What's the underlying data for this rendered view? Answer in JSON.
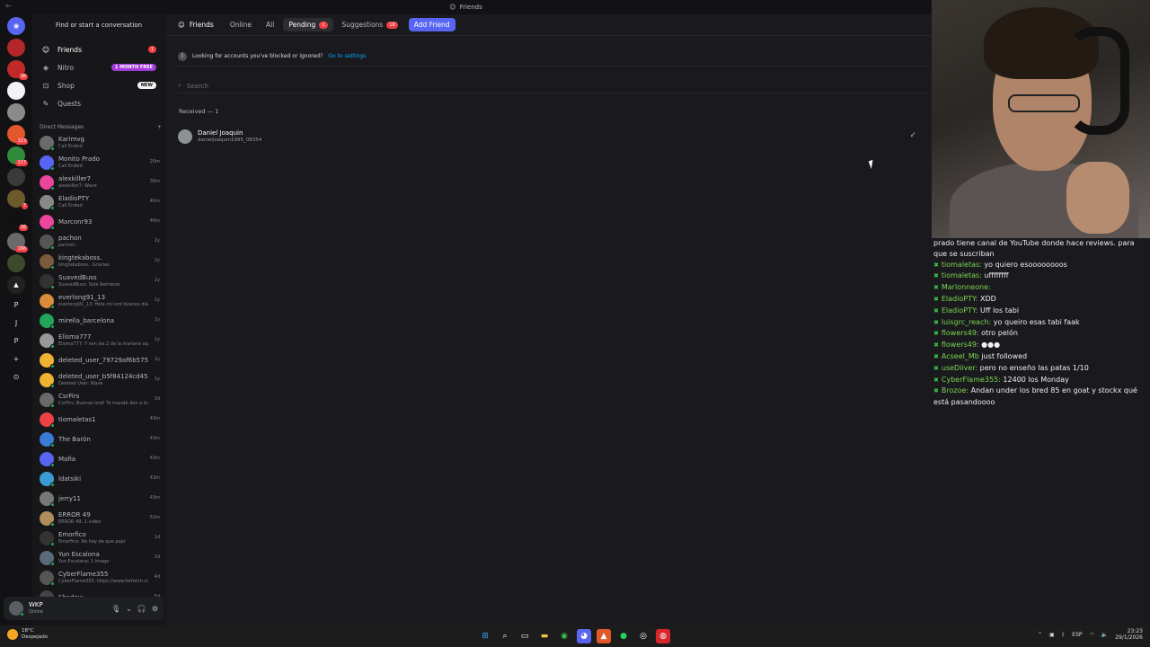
{
  "window": {
    "title": "Friends"
  },
  "rail": {
    "servers": [
      {
        "color": "#5865f2",
        "badge": "",
        "glyph": "◉"
      },
      {
        "color": "#b3262a",
        "badge": "",
        "glyph": ""
      },
      {
        "color": "#c22a2a",
        "badge": "36",
        "glyph": ""
      },
      {
        "color": "#f2f3f5",
        "badge": "",
        "glyph": ""
      },
      {
        "color": "#8a8a8a",
        "badge": "",
        "glyph": ""
      },
      {
        "color": "#e0582b",
        "badge": "323",
        "glyph": ""
      },
      {
        "color": "#2f8a3c",
        "badge": "117",
        "glyph": ""
      },
      {
        "color": "#3a3a3a",
        "badge": "",
        "glyph": ""
      },
      {
        "color": "#6c5a2a",
        "badge": "7",
        "glyph": ""
      },
      {
        "color": "#111111",
        "badge": "38",
        "glyph": ""
      },
      {
        "color": "#6a6a6a",
        "badge": "166",
        "glyph": ""
      },
      {
        "color": "#3b4a2a",
        "badge": "",
        "glyph": ""
      },
      {
        "color": "#222222",
        "badge": "",
        "glyph": "▲"
      }
    ],
    "letters": [
      "P",
      "J",
      "P"
    ]
  },
  "sidebar": {
    "find_placeholder": "Find or start a conversation",
    "nav": [
      {
        "label": "Friends",
        "icon": "friends-icon",
        "badge": "1",
        "badge_type": "red"
      },
      {
        "label": "Nitro",
        "icon": "nitro-icon",
        "badge": "1 MONTH FREE",
        "badge_type": "purple"
      },
      {
        "label": "Shop",
        "icon": "shop-icon",
        "badge": "NEW",
        "badge_type": "white"
      },
      {
        "label": "Quests",
        "icon": "quests-icon",
        "badge": "",
        "badge_type": ""
      }
    ],
    "dm_header": "Direct Messages",
    "dms": [
      {
        "name": "Karimvg",
        "sub": "Call Ended",
        "time": "",
        "color": "#6a6a6a"
      },
      {
        "name": "Monito Prado",
        "sub": "Call Ended",
        "time": "20m",
        "color": "#5865f2"
      },
      {
        "name": "alexkiller7",
        "sub": "alexkiller7: Wave",
        "time": "30m",
        "color": "#eb459e"
      },
      {
        "name": "EladioPTY",
        "sub": "Call Ended",
        "time": "40m",
        "color": "#888888"
      },
      {
        "name": "Marconr93",
        "sub": "",
        "time": "40m",
        "color": "#eb459e"
      },
      {
        "name": "pachon",
        "sub": "pachon:",
        "time": "2y",
        "color": "#555555"
      },
      {
        "name": "kingtekaboss.",
        "sub": "kingtekaboss.: Gracias",
        "time": "2y",
        "color": "#7a5a3a"
      },
      {
        "name": "SuavedBuss",
        "sub": "SuavedBuss: Sole Retriever",
        "time": "2y",
        "color": "#333333"
      },
      {
        "name": "everlong91_13",
        "sub": "everlong91_13: Hola mi lord buenos días s...",
        "time": "1y",
        "color": "#d98c3a"
      },
      {
        "name": "mirella_barcelona",
        "sub": "",
        "time": "1y",
        "color": "#23a55a"
      },
      {
        "name": "Elisma777",
        "sub": "Elisma777: Y son las 2 de la mañana aquí ...",
        "time": "1y",
        "color": "#999999"
      },
      {
        "name": "deleted_user_79729af6b575",
        "sub": "",
        "time": "1y",
        "color": "#f0b232"
      },
      {
        "name": "deleted_user_b5f84124cd45",
        "sub": "Deleted User: Wave",
        "time": "1y",
        "color": "#f0b232"
      },
      {
        "name": "CsrFirs",
        "sub": "CsrFirs: Buenas lord! Te mandé den a Insta...",
        "time": "3d",
        "color": "#6a6a6a"
      },
      {
        "name": "tiomaletas1",
        "sub": "",
        "time": "43m",
        "color": "#ed4245"
      },
      {
        "name": "The Barón",
        "sub": "",
        "time": "43m",
        "color": "#3a7bd5"
      },
      {
        "name": "Mafia",
        "sub": "",
        "time": "43m",
        "color": "#5865f2"
      },
      {
        "name": "ldatsiki",
        "sub": "",
        "time": "43m",
        "color": "#3a9bd5"
      },
      {
        "name": "jerry11",
        "sub": "",
        "time": "43m",
        "color": "#777777"
      },
      {
        "name": "ERROR 49",
        "sub": "ERROR 49: 1 video",
        "time": "52m",
        "color": "#b08d5a"
      },
      {
        "name": "Emorfico",
        "sub": "Emorfico: No hay de que papi",
        "time": "1d",
        "color": "#333333"
      },
      {
        "name": "Yun Escalona",
        "sub": "Yun Escalona: 1 image",
        "time": "1d",
        "color": "#5a6a7a"
      },
      {
        "name": "CyberFlame355",
        "sub": "CyberFlame355: https://www.farfetch.co...",
        "time": "4d",
        "color": "#555555"
      },
      {
        "name": "Shadow",
        "sub": "",
        "time": "5d",
        "color": "#444444"
      }
    ]
  },
  "user": {
    "name": "WKP",
    "status": "Online"
  },
  "main": {
    "friends_label": "Friends",
    "tabs": [
      {
        "label": "Online",
        "badge": ""
      },
      {
        "label": "All",
        "badge": ""
      },
      {
        "label": "Pending",
        "badge": "1"
      },
      {
        "label": "Suggestions",
        "badge": "18"
      }
    ],
    "add_friend": "Add Friend",
    "notice": "Looking for accounts you've blocked or ignored?",
    "notice_link": "Go to settings",
    "search_placeholder": "Search",
    "received_header": "Received — 1",
    "request": {
      "name": "Daniel Joaquin",
      "username": "danieljoaquin1995_08354"
    }
  },
  "chat": [
    {
      "user": "",
      "msg": "prado tiene canal de YouTube donde hace reviews. para que se suscriban"
    },
    {
      "user": "tiomaletas:",
      "msg": " yo quiero esoooooooos"
    },
    {
      "user": "tiomaletas:",
      "msg": " uffffffff"
    },
    {
      "user": "Marlonneone:",
      "msg": ""
    },
    {
      "user": "EladioPTY:",
      "msg": " XDD"
    },
    {
      "user": "EladioPTY:",
      "msg": " Uff los tabi"
    },
    {
      "user": "luisgrc_reach:",
      "msg": " yo queiro esas tabi faak"
    },
    {
      "user": "flowers49:",
      "msg": " otro pelón"
    },
    {
      "user": "flowers49:",
      "msg": " ●●●"
    },
    {
      "user": "Acseel_Mb",
      "msg": " just followed"
    },
    {
      "user": "useDiiver:",
      "msg": " pero no enseño las patas 1/10"
    },
    {
      "user": "CyberFlame355:",
      "msg": " 12400 los Monday"
    },
    {
      "user": "Brozoe:",
      "msg": " Andan under los bred 85 en goat y stockx qué está pasandoooo"
    }
  ],
  "taskbar": {
    "temp": "18°C",
    "weather": "Despejado",
    "lang": "ESP",
    "time": "23:23",
    "date": "29/1/2026"
  }
}
